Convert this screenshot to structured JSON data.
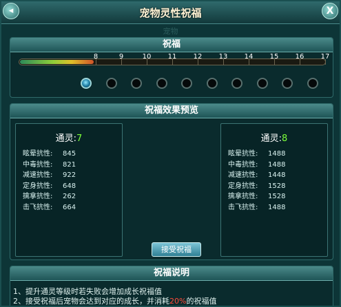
{
  "window": {
    "title": "宠物灵性祝福",
    "ghost_text": "宠物",
    "close_label": "X",
    "back_label": "◂"
  },
  "bless": {
    "header": "祝福",
    "ticks": [
      "8",
      "9",
      "10",
      "11",
      "12",
      "13",
      "14",
      "15",
      "16",
      "17"
    ],
    "progress": 0.24,
    "dots_total": 10,
    "dots_active": 1
  },
  "preview": {
    "header": "祝福效果预览",
    "current": {
      "level_label": "通灵:",
      "level_value": "7",
      "stats": [
        {
          "label": "眩晕抗性:",
          "value": "845"
        },
        {
          "label": "中毒抗性:",
          "value": "821"
        },
        {
          "label": "减速抗性:",
          "value": "922"
        },
        {
          "label": "定身抗性:",
          "value": "648"
        },
        {
          "label": "擒拿抗性:",
          "value": "262"
        },
        {
          "label": "击飞抗性:",
          "value": "664"
        }
      ]
    },
    "next": {
      "level_label": "通灵:",
      "level_value": "8",
      "stats": [
        {
          "label": "眩晕抗性:",
          "value": "1488"
        },
        {
          "label": "中毒抗性:",
          "value": "1488"
        },
        {
          "label": "减速抗性:",
          "value": "1448"
        },
        {
          "label": "定身抗性:",
          "value": "1528"
        },
        {
          "label": "擒拿抗性:",
          "value": "1528"
        },
        {
          "label": "击飞抗性:",
          "value": "1488"
        }
      ]
    },
    "accept_label": "接受祝福"
  },
  "notes": {
    "header": "祝福说明",
    "line1": "1、提升通灵等级时若失败会增加成长祝福值",
    "line2_a": "2、接受祝福后宠物会达到对应的成长，并消耗",
    "line2_hl": "20%",
    "line2_b": "的祝福值"
  },
  "colors": {
    "accent": "#7cff3a",
    "highlight": "#ff4b3a",
    "panel": "#0a2b2d"
  }
}
